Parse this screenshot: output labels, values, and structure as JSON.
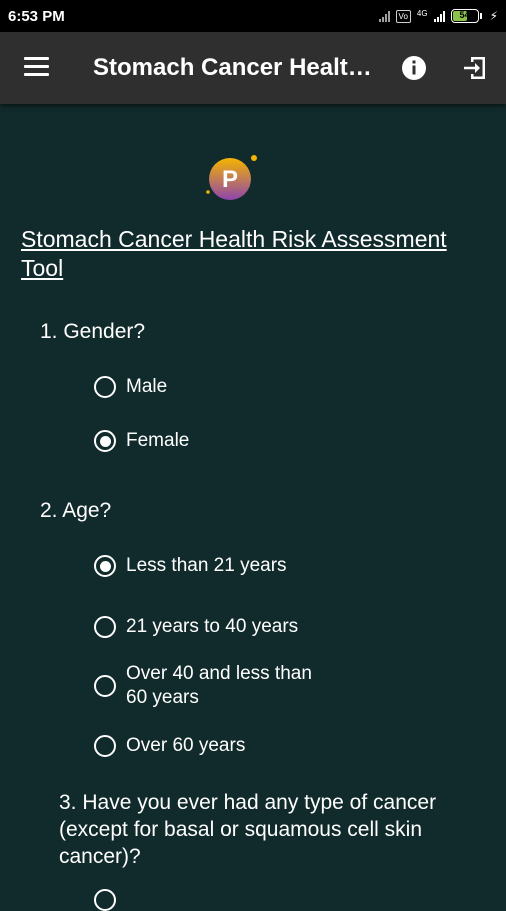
{
  "status_bar": {
    "time": "6:53 PM",
    "volte": "Vo",
    "network": "4G",
    "battery": "54"
  },
  "app_bar": {
    "title": "Stomach Cancer Health Risk Assessment Tool",
    "menu_icon": "hamburger-menu-icon",
    "info_icon": "info-icon",
    "exit_icon": "exit-icon"
  },
  "logo": {
    "letter": "P",
    "colors": {
      "top": "#f5b400",
      "bottom": "#8e44ad"
    }
  },
  "page": {
    "title": "Stomach Cancer Health Risk Assessment Tool"
  },
  "questions": [
    {
      "text": "1. Gender?",
      "options": [
        {
          "label": "Male",
          "selected": false
        },
        {
          "label": "Female",
          "selected": true
        }
      ]
    },
    {
      "text": "2. Age?",
      "options": [
        {
          "label": "Less than 21 years",
          "selected": true
        },
        {
          "label": "21 years to 40 years",
          "selected": false
        },
        {
          "label": "Over 40 and less than 60 years",
          "selected": false
        },
        {
          "label": "Over 60 years",
          "selected": false
        }
      ]
    },
    {
      "text": "3. Have you ever had any type of cancer (except for basal or squamous cell skin cancer)?",
      "options": [
        {
          "label": "",
          "selected": false
        }
      ]
    }
  ],
  "colors": {
    "background": "#112a2b",
    "app_bar": "#2f2f2f",
    "status_bar": "#000000",
    "text": "#ffffff"
  }
}
